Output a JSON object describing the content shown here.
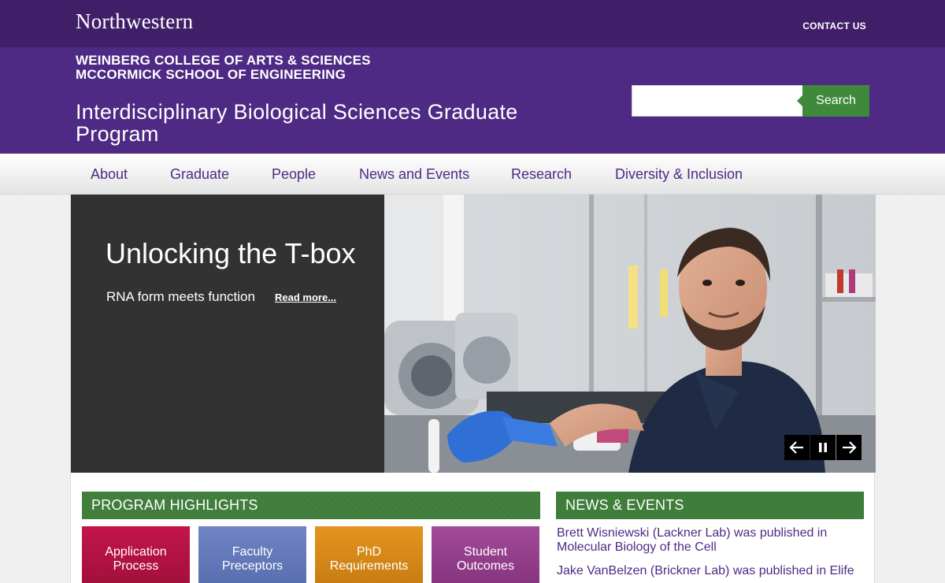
{
  "topbar": {
    "logo": "Northwestern",
    "contact": "CONTACT US"
  },
  "header": {
    "schools": [
      "WEINBERG COLLEGE OF ARTS & SCIENCES",
      "MCCORMICK SCHOOL OF ENGINEERING"
    ],
    "site_title": "Interdisciplinary Biological Sciences Graduate Program"
  },
  "search": {
    "value": "",
    "button_label": "Search"
  },
  "nav": {
    "items": [
      {
        "label": "About"
      },
      {
        "label": "Graduate"
      },
      {
        "label": "People"
      },
      {
        "label": "News and Events"
      },
      {
        "label": "Research"
      },
      {
        "label": "Diversity & Inclusion"
      }
    ]
  },
  "hero": {
    "title": "Unlocking the T-box",
    "subtitle": "RNA form meets function",
    "read_more": "Read more...",
    "controls": {
      "prev": "arrow-left-icon",
      "pause": "pause-icon",
      "next": "arrow-right-icon"
    }
  },
  "highlights": {
    "title": "PROGRAM HIGHLIGHTS",
    "tiles": [
      {
        "line1": "Application",
        "line2": "Process",
        "color": "#b5124a"
      },
      {
        "line1": "Faculty",
        "line2": "Preceptors",
        "color": "#6479bd"
      },
      {
        "line1": "PhD",
        "line2": "Requirements",
        "color": "#d68918"
      },
      {
        "line1": "Student",
        "line2": "Outcomes",
        "color": "#95408d"
      }
    ]
  },
  "news": {
    "title": "NEWS & EVENTS",
    "items": [
      "Brett Wisniewski (Lackner Lab) was published in Molecular Biology of the Cell",
      "Jake VanBelzen (Brickner Lab) was published in Elife"
    ]
  },
  "colors": {
    "topbar": "#401f68",
    "header": "#4e2a84",
    "accent_green": "#3f8a3a",
    "nav_text": "#4e2a84"
  }
}
